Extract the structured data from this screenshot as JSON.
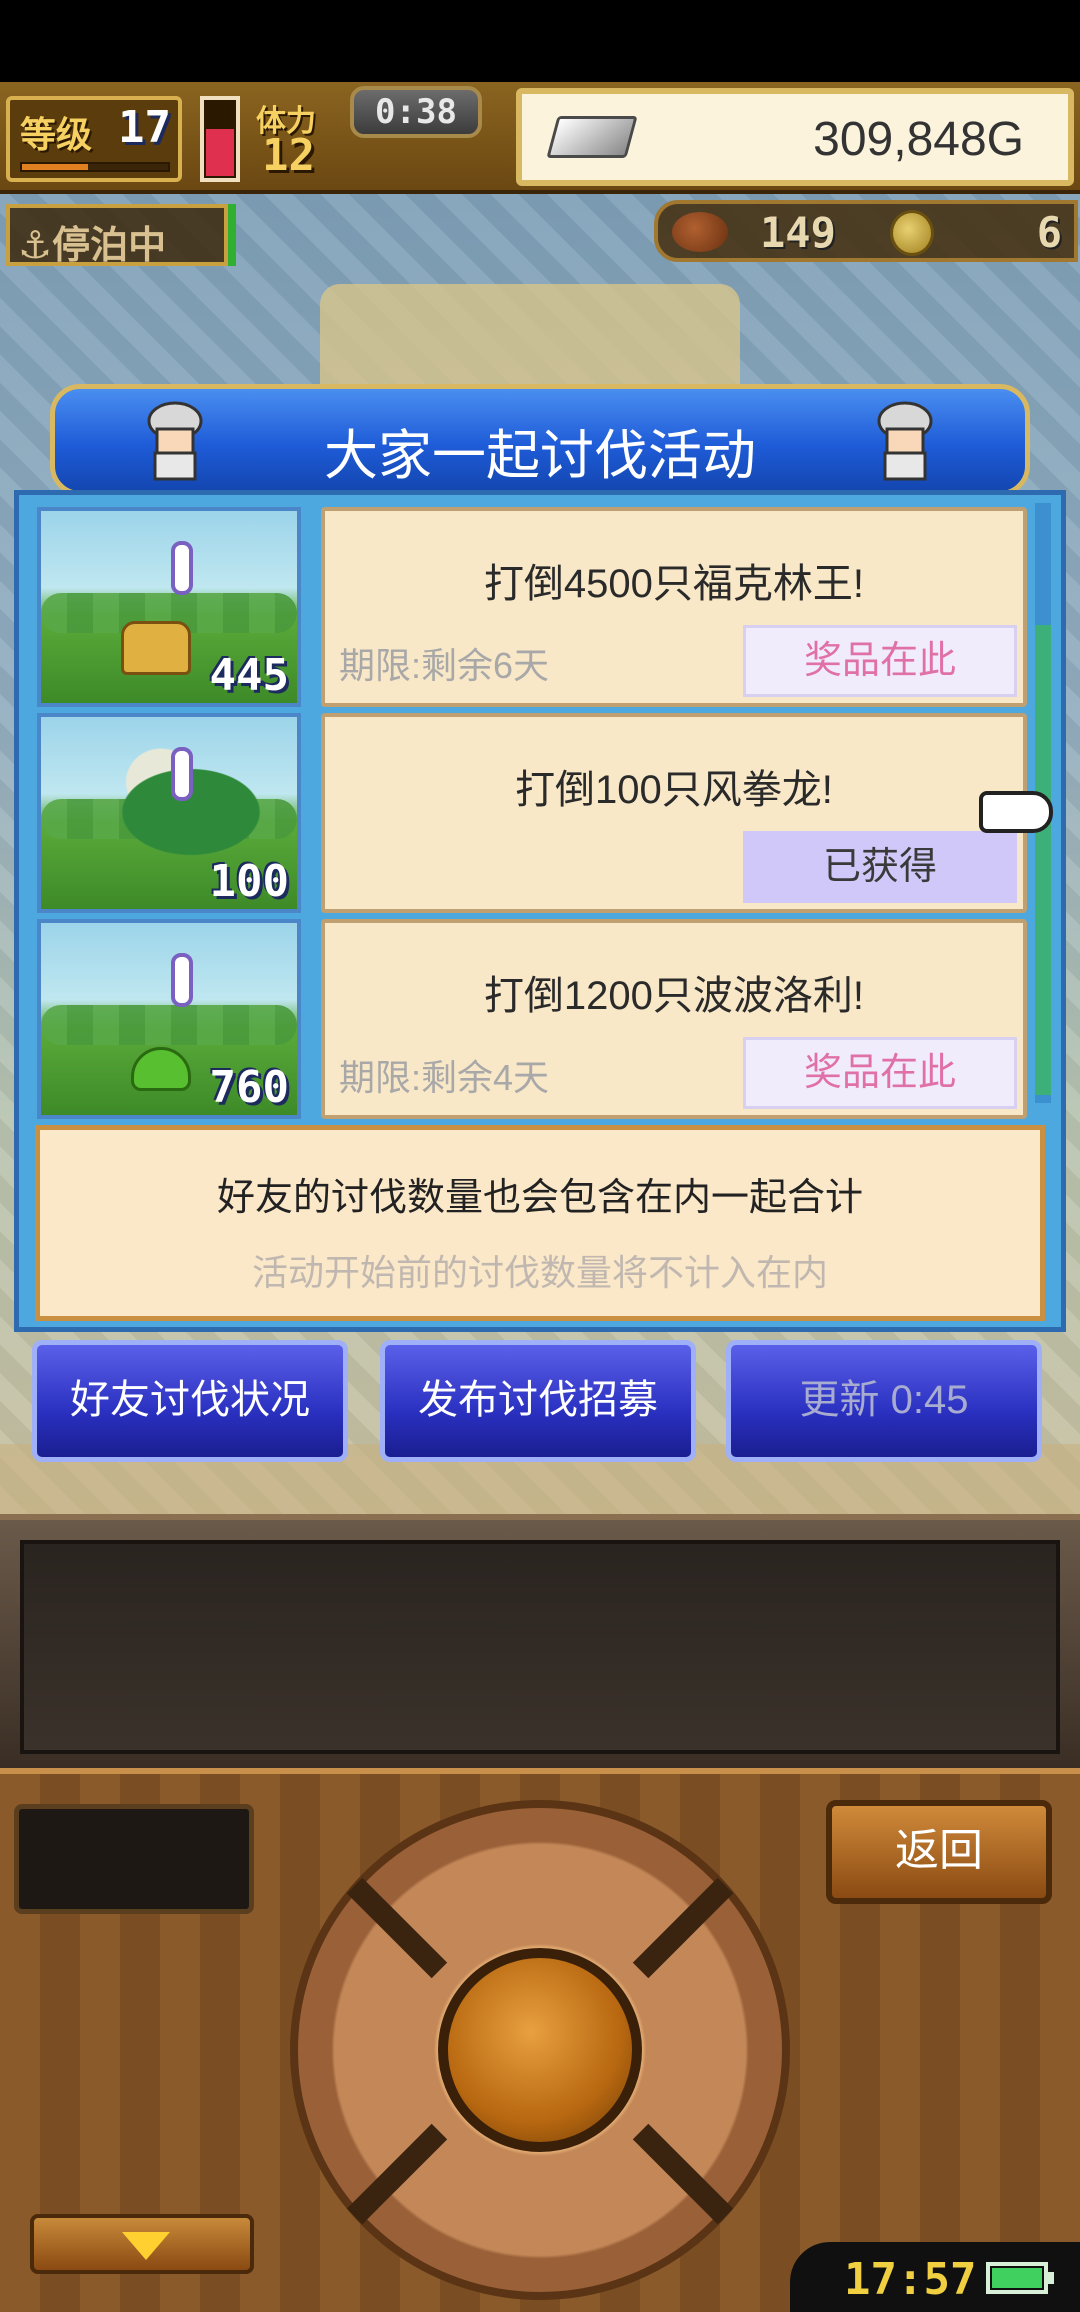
{
  "hud": {
    "level_label": "等级",
    "level": "17",
    "stamina_label": "体力",
    "stamina": "12",
    "timer": "0:38",
    "gold": "309,848G",
    "anchor_status": "⚓停泊中",
    "food": "149",
    "coins": "6",
    "level_progress": 0.45,
    "hp_fill": 0.6
  },
  "dialog": {
    "title": "大家一起讨伐活动",
    "events": [
      {
        "title": "打倒4500只福克林王!",
        "limit": "期限:剩余6天",
        "action": "奖品在此",
        "count": "445",
        "monster": "king-monster"
      },
      {
        "title": "打倒100只风拳龙!",
        "limit": "",
        "action": "已获得",
        "count": "100",
        "monster": "dragon-monster"
      },
      {
        "title": "打倒1200只波波洛利!",
        "limit": "期限:剩余4天",
        "action": "奖品在此",
        "count": "760",
        "monster": "slime-monster"
      }
    ],
    "info_main": "好友的讨伐数量也会包含在内一起合计",
    "info_sub": "活动开始前的讨伐数量将不计入在内"
  },
  "buttons": {
    "friends_status": "好友讨伐状况",
    "post_recruit": "发布讨伐招募",
    "refresh": "更新 0:45"
  },
  "controller": {
    "back": "返回",
    "clock": "17:57"
  },
  "colors": {
    "banner_blue": "#1f5cd8",
    "panel_blue": "#4ea8e0",
    "card_bg": "#f8e8c8",
    "prize_pink": "#e070a8",
    "button_blue": "#2a30c0"
  }
}
